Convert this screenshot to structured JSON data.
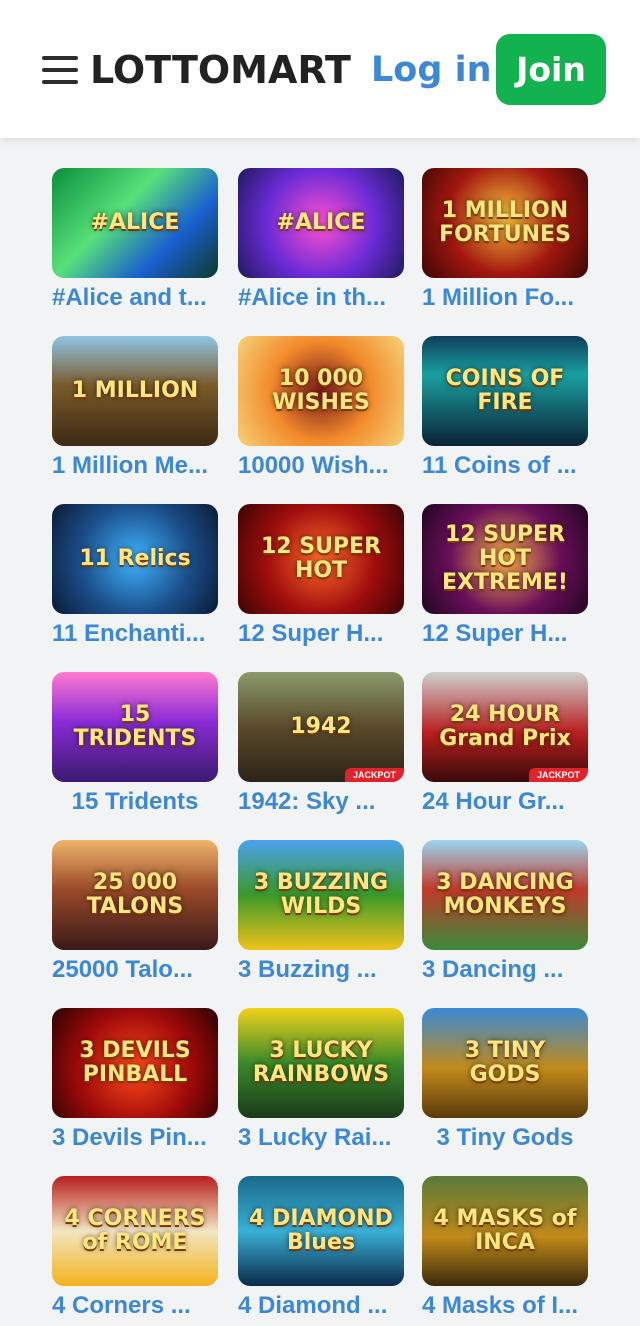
{
  "header": {
    "logo": "LOTTOMART",
    "login_label": "Log in",
    "join_label": "Join"
  },
  "games": [
    {
      "title": "#Alice and t...",
      "thumb_text": "#ALICE",
      "bg": "linear-gradient(135deg,#0a8f3c,#57e07a 40%,#1a5fd0 70%,#0b3a2a)",
      "jackpot": ""
    },
    {
      "title": "#Alice in th...",
      "thumb_text": "#ALICE",
      "bg": "radial-gradient(circle at 50% 50%,#ff4fd2,#6a2bd6 55%,#1f1a5c)",
      "jackpot": ""
    },
    {
      "title": "1 Million Fo...",
      "thumb_text": "1 MILLION FORTUNES",
      "bg": "radial-gradient(circle at 50% 45%,#f7c23a,#a3170f 55%,#3a0606)",
      "jackpot": ""
    },
    {
      "title": "1 Million Me...",
      "thumb_text": "1 MILLION",
      "bg": "linear-gradient(180deg,#8fc6e6,#7a5a2a 45%,#3c2a15)",
      "jackpot": ""
    },
    {
      "title": "10000 Wish...",
      "thumb_text": "10 000 WISHES",
      "bg": "radial-gradient(circle at 50% 50%,#7a1a1a,#f28a2b 50%,#f6d27a)",
      "jackpot": ""
    },
    {
      "title": "11 Coins of ...",
      "thumb_text": "COINS OF FIRE",
      "bg": "linear-gradient(180deg,#0f3e5c,#1aa0a0 35%,#0b2236)",
      "jackpot": ""
    },
    {
      "title": "11 Enchanti...",
      "thumb_text": "11 Relics",
      "bg": "radial-gradient(circle at 50% 50%,#3fb3ff,#1b4e8a 55%,#0a1a36)",
      "jackpot": ""
    },
    {
      "title": "12 Super H...",
      "thumb_text": "12 SUPER HOT",
      "bg": "radial-gradient(circle at 50% 50%,#ff6a2a,#a00d0d 55%,#3a0404)",
      "jackpot": ""
    },
    {
      "title": "12 Super H...",
      "thumb_text": "12 SUPER HOT EXTREME!",
      "bg": "radial-gradient(circle at 50% 50%,#ffb34a,#6a0f5a 55%,#1f0520)",
      "jackpot": ""
    },
    {
      "title": "15 Tridents",
      "thumb_text": "15 TRIDENTS",
      "bg": "linear-gradient(180deg,#ff7ad0,#8a2bd6 45%,#3a1a6e)",
      "jackpot": ""
    },
    {
      "title": "1942: Sky ...",
      "thumb_text": "1942",
      "bg": "linear-gradient(180deg,#8a9a6a,#5a4a2a 50%,#2a2418)",
      "jackpot": "JACKPOT"
    },
    {
      "title": "24 Hour Gr...",
      "thumb_text": "24 HOUR Grand Prix",
      "bg": "linear-gradient(180deg,#cfcfcf,#b81f1f 55%,#3a0a0a)",
      "jackpot": "JACKPOT"
    },
    {
      "title": "25000 Talo...",
      "thumb_text": "25 000 TALONS",
      "bg": "linear-gradient(180deg,#f0b46a,#9a4a2a 45%,#3a1a1a)",
      "jackpot": ""
    },
    {
      "title": "3 Buzzing ...",
      "thumb_text": "3 BUZZING WILDS",
      "bg": "linear-gradient(180deg,#4aa0f0,#3a9a2a 50%,#f2c21a)",
      "jackpot": ""
    },
    {
      "title": "3 Dancing ...",
      "thumb_text": "3 DANCING MONKEYS",
      "bg": "linear-gradient(180deg,#9ad6f0,#c23a2a 45%,#3a8a3a)",
      "jackpot": ""
    },
    {
      "title": "3 Devils Pin...",
      "thumb_text": "3 DEVILS PINBALL",
      "bg": "radial-gradient(circle at 50% 55%,#ff4a1a,#a00a0a 55%,#2a0202)",
      "jackpot": ""
    },
    {
      "title": "3 Lucky Rai...",
      "thumb_text": "3 LUCKY RAINBOWS",
      "bg": "linear-gradient(180deg,#f2d21a,#3a8a2a 50%,#1a3a1a)",
      "jackpot": ""
    },
    {
      "title": "3 Tiny Gods",
      "thumb_text": "3 TINY GODS",
      "bg": "linear-gradient(180deg,#3a8ad6,#c28a1a 55%,#5a3a0a)",
      "jackpot": ""
    },
    {
      "title": "4 Corners ...",
      "thumb_text": "4 CORNERS of ROME",
      "bg": "linear-gradient(180deg,#b81f1f,#f2e6c2 50%,#f2b21a)",
      "jackpot": ""
    },
    {
      "title": "4 Diamond ...",
      "thumb_text": "4 DIAMOND Blues",
      "bg": "linear-gradient(180deg,#1a6a8a,#3ab0d6 50%,#0a2a4a)",
      "jackpot": ""
    },
    {
      "title": "4 Masks of I...",
      "thumb_text": "4 MASKS of INCA",
      "bg": "linear-gradient(180deg,#5a7a3a,#c28a1a 55%,#3a2a0a)",
      "jackpot": ""
    }
  ]
}
